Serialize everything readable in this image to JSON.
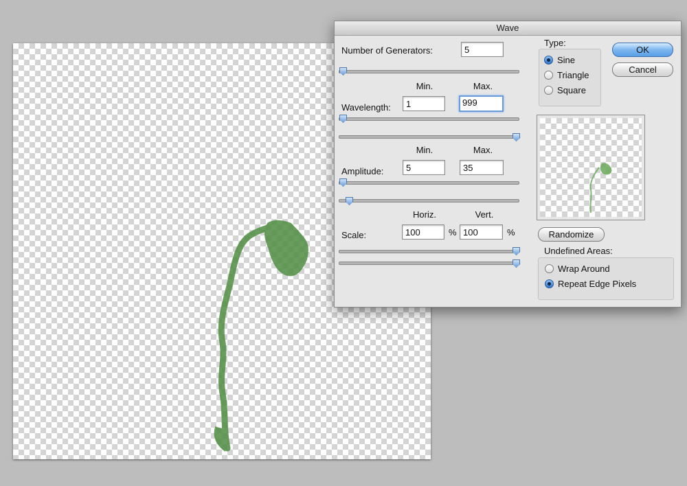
{
  "dialog": {
    "title": "Wave",
    "generators": {
      "label": "Number of Generators:",
      "value": "5",
      "slider": 0.01
    },
    "min_header": "Min.",
    "max_header": "Max.",
    "wavelength": {
      "label": "Wavelength:",
      "min": "1",
      "max": "999",
      "min_slider": 0.0,
      "max_slider": 1.0
    },
    "amplitude": {
      "label": "Amplitude:",
      "min": "5",
      "max": "35",
      "min_slider": 0.01,
      "max_slider": 0.04
    },
    "scale": {
      "label": "Scale:",
      "horiz_header": "Horiz.",
      "vert_header": "Vert.",
      "horiz": "100",
      "vert": "100",
      "unit": "%",
      "horiz_slider": 1.0,
      "vert_slider": 1.0
    },
    "type": {
      "label": "Type:",
      "options": [
        {
          "label": "Sine",
          "selected": true
        },
        {
          "label": "Triangle",
          "selected": false
        },
        {
          "label": "Square",
          "selected": false
        }
      ]
    },
    "ok_label": "OK",
    "cancel_label": "Cancel",
    "randomize_label": "Randomize",
    "undefined_areas": {
      "label": "Undefined Areas:",
      "options": [
        {
          "label": "Wrap Around",
          "selected": false
        },
        {
          "label": "Repeat Edge Pixels",
          "selected": true
        }
      ]
    }
  },
  "colors": {
    "plant": "#5a9a4c",
    "accent": "#5a9ee6"
  }
}
